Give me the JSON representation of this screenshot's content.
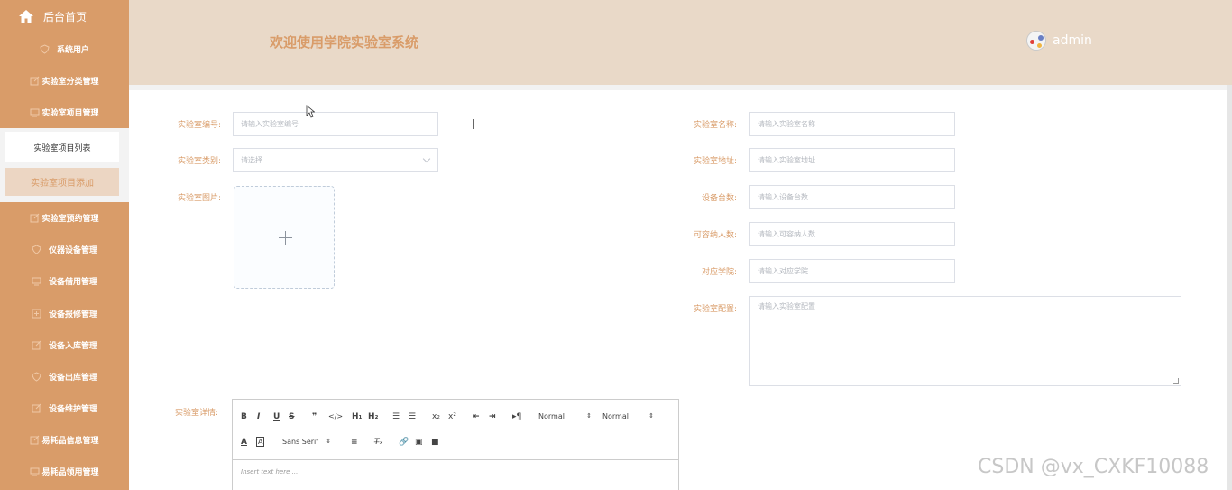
{
  "sidebar": {
    "home": "后台首页",
    "items": [
      {
        "label": "系统用户",
        "icon": "shield-icon"
      },
      {
        "label": "实验室分类管理",
        "icon": "edit-icon"
      },
      {
        "label": "实验室项目管理",
        "icon": "monitor-icon"
      },
      {
        "label": "实验室预约管理",
        "icon": "edit-icon"
      },
      {
        "label": "仪器设备管理",
        "icon": "shield-icon"
      },
      {
        "label": "设备借用管理",
        "icon": "monitor-icon"
      },
      {
        "label": "设备报修管理",
        "icon": "plus-box-icon"
      },
      {
        "label": "设备入库管理",
        "icon": "edit-icon"
      },
      {
        "label": "设备出库管理",
        "icon": "shield-icon"
      },
      {
        "label": "设备维护管理",
        "icon": "edit-icon"
      },
      {
        "label": "易耗品信息管理",
        "icon": "edit-icon"
      },
      {
        "label": "易耗品领用管理",
        "icon": "monitor-icon"
      }
    ],
    "submenu": [
      "实验室项目列表",
      "实验室项目添加"
    ]
  },
  "header": {
    "title": "欢迎使用学院实验室系统",
    "user": "admin"
  },
  "form": {
    "lab_number": {
      "label": "实验室编号:",
      "placeholder": "请输入实验室编号"
    },
    "lab_category": {
      "label": "实验室类别:",
      "placeholder": "请选择"
    },
    "lab_image": {
      "label": "实验室图片:"
    },
    "lab_name": {
      "label": "实验室名称:",
      "placeholder": "请输入实验室名称"
    },
    "lab_address": {
      "label": "实验室地址:",
      "placeholder": "请输入实验室地址"
    },
    "device_count": {
      "label": "设备台数:",
      "placeholder": "请输入设备台数"
    },
    "capacity": {
      "label": "可容纳人数:",
      "placeholder": "请输入可容纳人数"
    },
    "college": {
      "label": "对应学院:",
      "placeholder": "请输入对应学院"
    },
    "config": {
      "label": "实验室配置:",
      "placeholder": "请输入实验室配置"
    },
    "details": {
      "label": "实验室详情:"
    }
  },
  "editor": {
    "header_picker": "Normal",
    "size_picker": "Normal",
    "font_picker": "Sans Serif",
    "placeholder": "Insert text here ..."
  },
  "colors": {
    "sidebar": "#d99c69",
    "header": "#e9d9c8",
    "accent": "#d99c69"
  },
  "watermark": "CSDN @vx_CXKF10088"
}
